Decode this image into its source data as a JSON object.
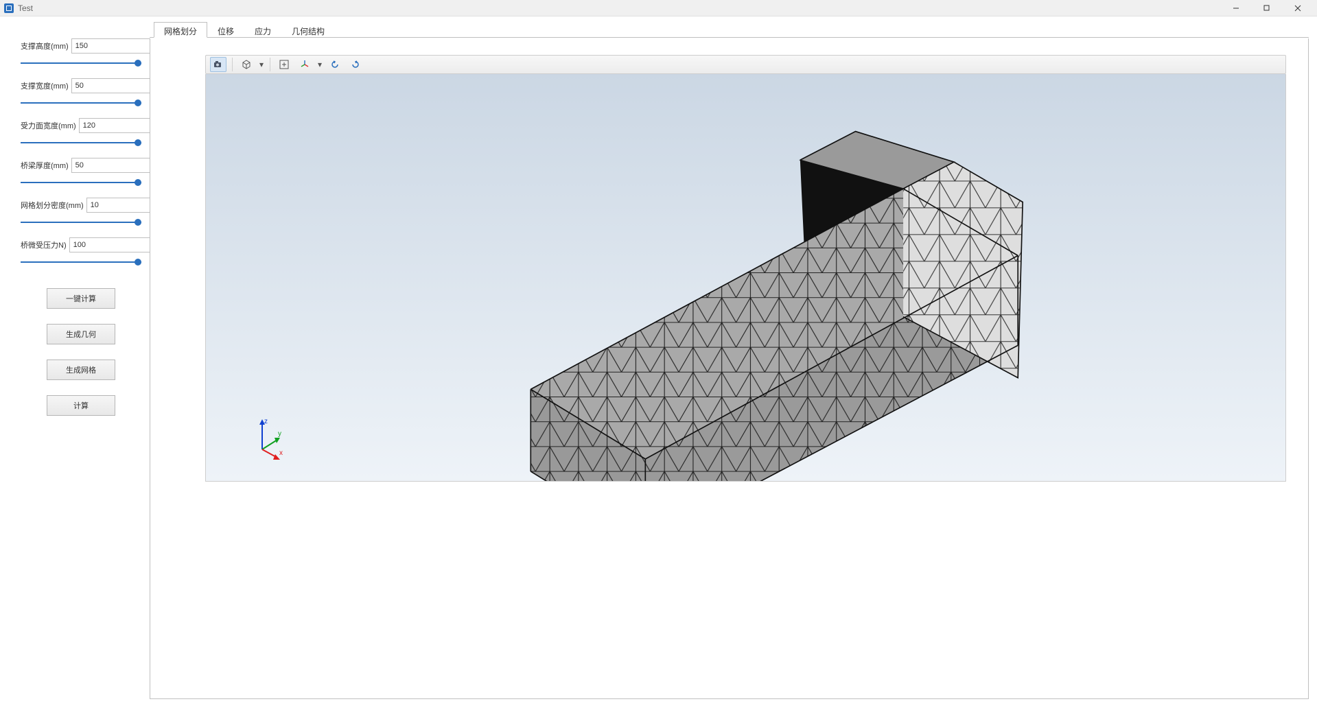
{
  "window": {
    "title": "Test"
  },
  "params": [
    {
      "label": "支撑高度(mm)",
      "value": "150"
    },
    {
      "label": "支撑宽度(mm)",
      "value": "50"
    },
    {
      "label": "受力面宽度(mm)",
      "value": "120"
    },
    {
      "label": "桥梁厚度(mm)",
      "value": "50"
    },
    {
      "label": "网格划分密度(mm)",
      "value": "10"
    },
    {
      "label": "桥微受压力N)",
      "value": "100"
    }
  ],
  "buttons": {
    "one_click_calc": "一键计算",
    "generate_geometry": "生成几何",
    "generate_mesh": "生成网格",
    "calculate": "计算"
  },
  "tabs": {
    "mesh": "网格划分",
    "displacement": "位移",
    "stress": "应力",
    "geometry": "几何结构",
    "active": "mesh"
  },
  "view_toolbar": {
    "camera": "camera-icon",
    "cube": "cube-icon",
    "fit": "fit-view-icon",
    "rotate_axes": "rotate-axes-icon",
    "rotate_ccw": "rotate-ccw-icon",
    "rotate_cw": "rotate-cw-icon"
  },
  "axis": {
    "z": "z",
    "y": "y",
    "x": "x"
  }
}
